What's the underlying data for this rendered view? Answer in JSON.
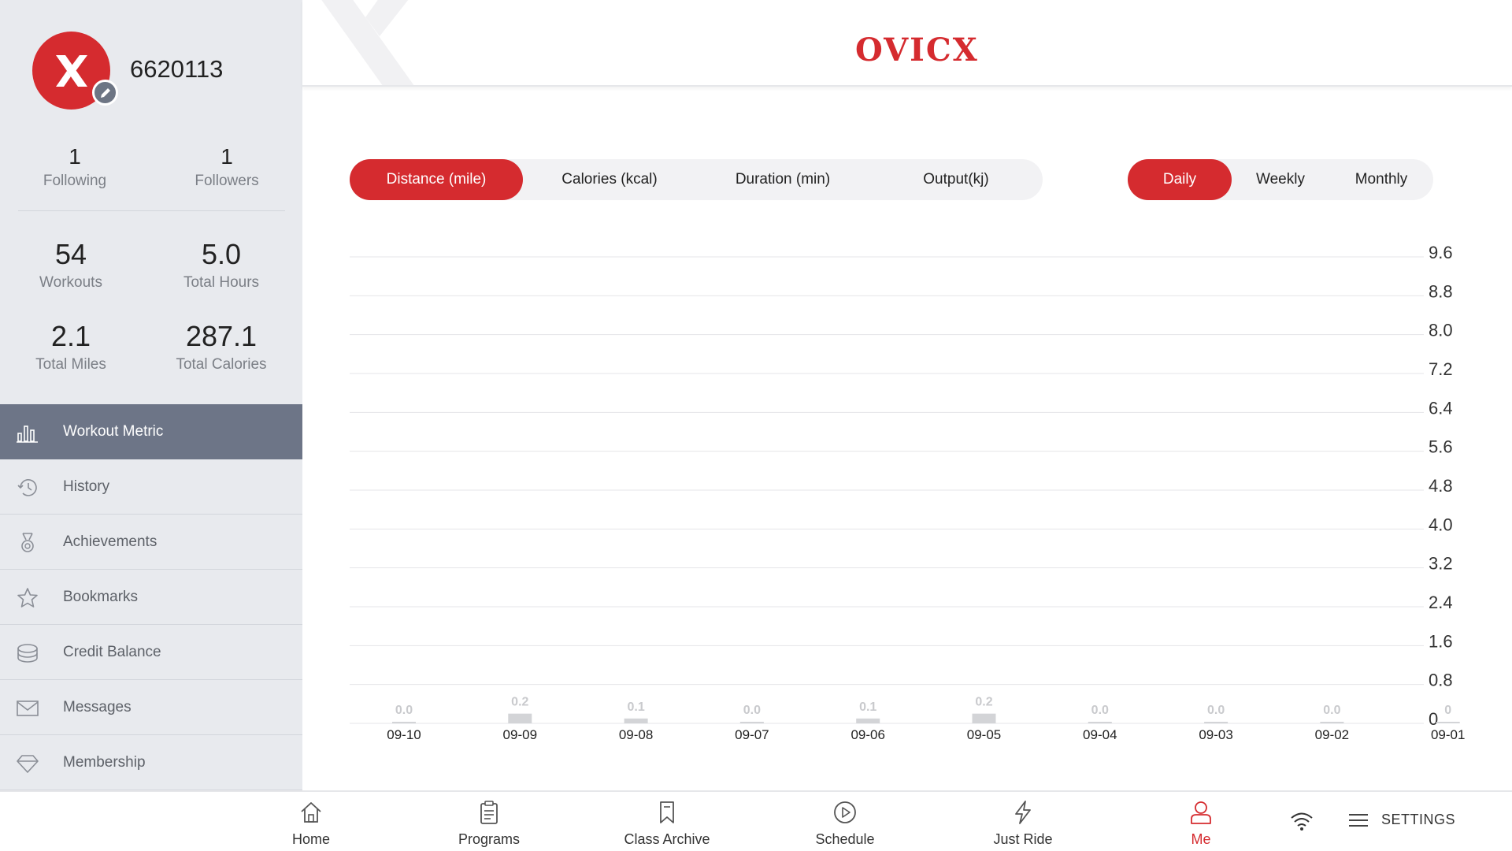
{
  "profile": {
    "username": "6620113"
  },
  "social": {
    "following": {
      "count": "1",
      "label": "Following"
    },
    "followers": {
      "count": "1",
      "label": "Followers"
    }
  },
  "stats": {
    "workouts": {
      "value": "54",
      "label": "Workouts"
    },
    "total_hours": {
      "value": "5.0",
      "label": "Total Hours"
    },
    "total_miles": {
      "value": "2.1",
      "label": "Total Miles"
    },
    "total_calories": {
      "value": "287.1",
      "label": "Total Calories"
    }
  },
  "menu": {
    "items": [
      {
        "label": "Workout Metric",
        "icon": "bar-chart-icon",
        "active": true
      },
      {
        "label": "History",
        "icon": "history-icon"
      },
      {
        "label": "Achievements",
        "icon": "medal-icon"
      },
      {
        "label": "Bookmarks",
        "icon": "star-icon"
      },
      {
        "label": "Credit Balance",
        "icon": "coins-icon"
      },
      {
        "label": "Messages",
        "icon": "envelope-icon"
      },
      {
        "label": "Membership",
        "icon": "diamond-icon"
      }
    ]
  },
  "header": {
    "logo_text": "OVICX"
  },
  "metric_tabs": [
    "Distance (mile)",
    "Calories (kcal)",
    "Duration (min)",
    "Output(kj)"
  ],
  "metric_active": "Distance (mile)",
  "period_tabs": [
    "Daily",
    "Weekly",
    "Monthly"
  ],
  "period_active": "Daily",
  "chart_data": {
    "type": "bar",
    "categories": [
      "09-10",
      "09-09",
      "09-08",
      "09-07",
      "09-06",
      "09-05",
      "09-04",
      "09-03",
      "09-02",
      "09-01"
    ],
    "values": [
      0.0,
      0.2,
      0.1,
      0.0,
      0.1,
      0.2,
      0.0,
      0.0,
      0.0,
      0
    ],
    "value_labels": [
      "0.0",
      "0.2",
      "0.1",
      "0.0",
      "0.1",
      "0.2",
      "0.0",
      "0.0",
      "0.0",
      "0"
    ],
    "y_ticks": [
      "0",
      "0.8",
      "1.6",
      "2.4",
      "3.2",
      "4.0",
      "4.8",
      "5.6",
      "6.4",
      "7.2",
      "8.0",
      "8.8",
      "9.6"
    ],
    "ylim": [
      0,
      9.6
    ],
    "y_axis_side": "right",
    "grid": true,
    "bar_color": "#d3d4d7",
    "label_color": "#c9cacd"
  },
  "bottom_nav": {
    "items": [
      {
        "label": "Home",
        "icon": "home-icon"
      },
      {
        "label": "Programs",
        "icon": "clipboard-icon"
      },
      {
        "label": "Class Archive",
        "icon": "bookmark-icon"
      },
      {
        "label": "Schedule",
        "icon": "play-circle-icon"
      },
      {
        "label": "Just Ride",
        "icon": "lightning-icon"
      },
      {
        "label": "Me",
        "icon": "user-icon",
        "active": true
      }
    ],
    "settings_label": "SETTINGS"
  },
  "colors": {
    "accent": "#d52b2f",
    "sidebar_bg": "#e8eaee",
    "menu_active_bg": "#6d7587"
  }
}
